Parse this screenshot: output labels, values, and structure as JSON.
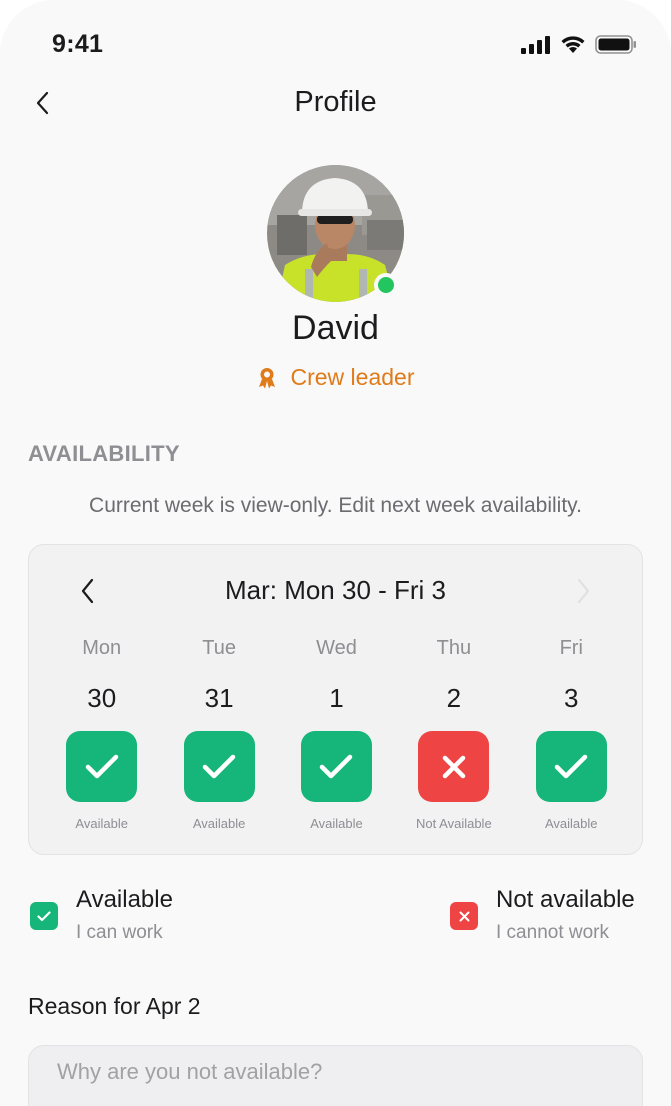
{
  "status_bar": {
    "time": "9:41"
  },
  "nav": {
    "title": "Profile"
  },
  "profile": {
    "name": "David",
    "role": "Crew leader",
    "online_color": "#22c55e",
    "role_color": "#e07b1a"
  },
  "availability": {
    "section_title": "AVAILABILITY",
    "note": "Current week is view-only. Edit next week availability.",
    "week_range": "Mar: Mon 30 - Fri 3",
    "days": [
      {
        "name": "Mon",
        "date": "30",
        "status": "available",
        "caption": "Available"
      },
      {
        "name": "Tue",
        "date": "31",
        "status": "available",
        "caption": "Available"
      },
      {
        "name": "Wed",
        "date": "1",
        "status": "available",
        "caption": "Available"
      },
      {
        "name": "Thu",
        "date": "2",
        "status": "not-available",
        "caption": "Not Available"
      },
      {
        "name": "Fri",
        "date": "3",
        "status": "available",
        "caption": "Available"
      }
    ]
  },
  "legend": {
    "available": {
      "title": "Available",
      "subtitle": "I can work",
      "color": "#16b57a"
    },
    "not_available": {
      "title": "Not available",
      "subtitle": "I cannot work",
      "color": "#ef4444"
    }
  },
  "reason": {
    "label": "Reason for Apr 2",
    "placeholder": "Why are you not available?"
  }
}
